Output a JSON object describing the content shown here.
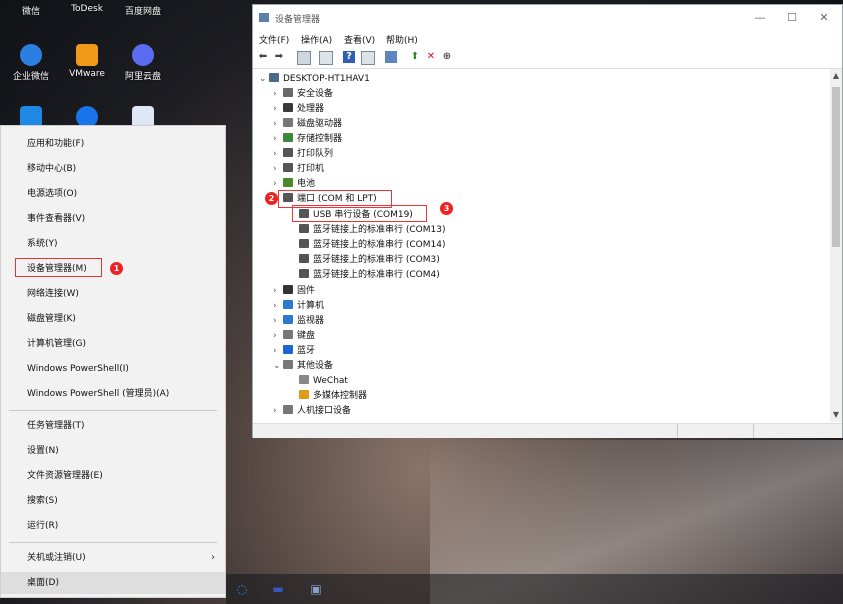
{
  "desktop": {
    "icons": [
      {
        "label": "微信",
        "icon": "wechat-icon"
      },
      {
        "label": "ToDesk",
        "icon": "todesk-icon"
      },
      {
        "label": "百度网盘",
        "icon": "baidu-netdisk-icon"
      },
      {
        "label": "企业微信",
        "icon": "wecom-icon",
        "color": "#2b7fe0"
      },
      {
        "label": "VMware",
        "icon": "vmware-icon",
        "color": "#f19a1a"
      },
      {
        "label": "阿里云盘",
        "icon": "aliyun-drive-icon",
        "color": "#5a6cf0"
      }
    ]
  },
  "context_menu": {
    "items": [
      "应用和功能(F)",
      "移动中心(B)",
      "电源选项(O)",
      "事件查看器(V)",
      "系统(Y)",
      "设备管理器(M)",
      "网络连接(W)",
      "磁盘管理(K)",
      "计算机管理(G)",
      "Windows PowerShell(I)",
      "Windows PowerShell (管理员)(A)",
      "任务管理器(T)",
      "设置(N)",
      "文件资源管理器(E)",
      "搜索(S)",
      "运行(R)",
      "关机或注销(U)",
      "桌面(D)"
    ],
    "badge_device_manager": "1"
  },
  "window": {
    "title": "设备管理器",
    "controls": {
      "minimize": "—",
      "maximize": "☐",
      "close": "✕"
    },
    "menu": [
      "文件(F)",
      "操作(A)",
      "查看(V)",
      "帮助(H)"
    ],
    "root": "DESKTOP-HT1HAV1",
    "tree": [
      {
        "label": "安全设备",
        "icon": "security-device-icon",
        "color": "#6a6a6a"
      },
      {
        "label": "处理器",
        "icon": "processor-icon",
        "color": "#3a3a3a"
      },
      {
        "label": "磁盘驱动器",
        "icon": "disk-drive-icon",
        "color": "#777"
      },
      {
        "label": "存储控制器",
        "icon": "storage-controller-icon",
        "color": "#3a8a3a"
      },
      {
        "label": "打印队列",
        "icon": "print-queue-icon",
        "color": "#555"
      },
      {
        "label": "打印机",
        "icon": "printer-icon",
        "color": "#555"
      },
      {
        "label": "电池",
        "icon": "battery-icon",
        "color": "#4a8a2a"
      },
      {
        "label": "端口 (COM 和 LPT)",
        "icon": "port-icon",
        "color": "#555"
      },
      {
        "label": "USB 串行设备 (COM19)",
        "icon": "port-icon",
        "color": "#555"
      },
      {
        "label": "蓝牙链接上的标准串行 (COM13)",
        "icon": "port-icon",
        "color": "#555"
      },
      {
        "label": "蓝牙链接上的标准串行 (COM14)",
        "icon": "port-icon",
        "color": "#555"
      },
      {
        "label": "蓝牙链接上的标准串行 (COM3)",
        "icon": "port-icon",
        "color": "#555"
      },
      {
        "label": "蓝牙链接上的标准串行 (COM4)",
        "icon": "port-icon",
        "color": "#555"
      },
      {
        "label": "固件",
        "icon": "firmware-icon",
        "color": "#333"
      },
      {
        "label": "计算机",
        "icon": "computer-icon",
        "color": "#2a7ad0"
      },
      {
        "label": "监视器",
        "icon": "monitor-icon",
        "color": "#2a7ad0"
      },
      {
        "label": "键盘",
        "icon": "keyboard-icon",
        "color": "#777"
      },
      {
        "label": "蓝牙",
        "icon": "bluetooth-icon",
        "color": "#1a66d6"
      },
      {
        "label": "其他设备",
        "icon": "other-devices-icon",
        "color": "#777"
      },
      {
        "label": "WeChat",
        "icon": "unknown-device-icon",
        "color": "#888"
      },
      {
        "label": "多媒体控制器",
        "icon": "warning-device-icon",
        "color": "#e09a1a"
      },
      {
        "label": "人机接口设备",
        "icon": "hid-icon",
        "color": "#777"
      }
    ],
    "badge_ports": "2",
    "badge_usb": "3"
  },
  "taskbar": {
    "icons": [
      "search-icon",
      "keyboard-icon",
      "device-manager-taskbar-icon"
    ]
  },
  "colors": {
    "highlight_red": "#e33333"
  }
}
